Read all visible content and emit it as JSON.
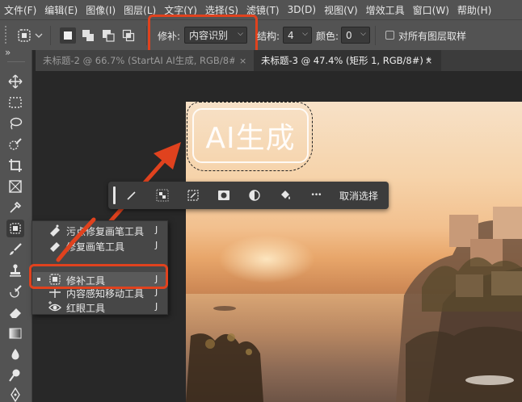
{
  "menu": [
    "文件(F)",
    "编辑(E)",
    "图像(I)",
    "图层(L)",
    "文字(Y)",
    "选择(S)",
    "滤镜(T)",
    "3D(D)",
    "视图(V)",
    "增效工具",
    "窗口(W)",
    "帮助(H)"
  ],
  "options": {
    "patch_label": "修补:",
    "patch_value": "内容识别",
    "structure_label": "结构:",
    "structure_value": "4",
    "color_label": "颜色:",
    "color_value": "0",
    "sample_all_label": "对所有图层取样"
  },
  "tabs": [
    {
      "label": "未标题-2 @ 66.7% (StartAI AI生成, RGB/8#)",
      "close": "×",
      "active": false
    },
    {
      "label": "未标题-3 @ 47.4% (矩形 1, RGB/8#) *",
      "close": "×",
      "active": true
    }
  ],
  "collapse_glyph": "»",
  "canvas": {
    "badge_text": "AI生成",
    "taskbar_deselect": "取消选择",
    "taskbar_more": "•••"
  },
  "flyout": [
    {
      "name": "污点修复画笔工具",
      "key": "J",
      "icon": "spot-healing-brush-icon",
      "selected": false
    },
    {
      "name": "修复画笔工具",
      "key": "J",
      "icon": "healing-brush-icon",
      "selected": false
    },
    {
      "name": "修补工具",
      "key": "J",
      "icon": "patch-icon",
      "selected": true
    },
    {
      "name": "内容感知移动工具",
      "key": "J",
      "icon": "content-aware-move-icon",
      "selected": false
    },
    {
      "name": "红眼工具",
      "key": "J",
      "icon": "red-eye-icon",
      "selected": false
    }
  ],
  "colors": {
    "highlight": "#e0421e",
    "ui_dark": "#535353",
    "canvas_bg": "#282828"
  }
}
